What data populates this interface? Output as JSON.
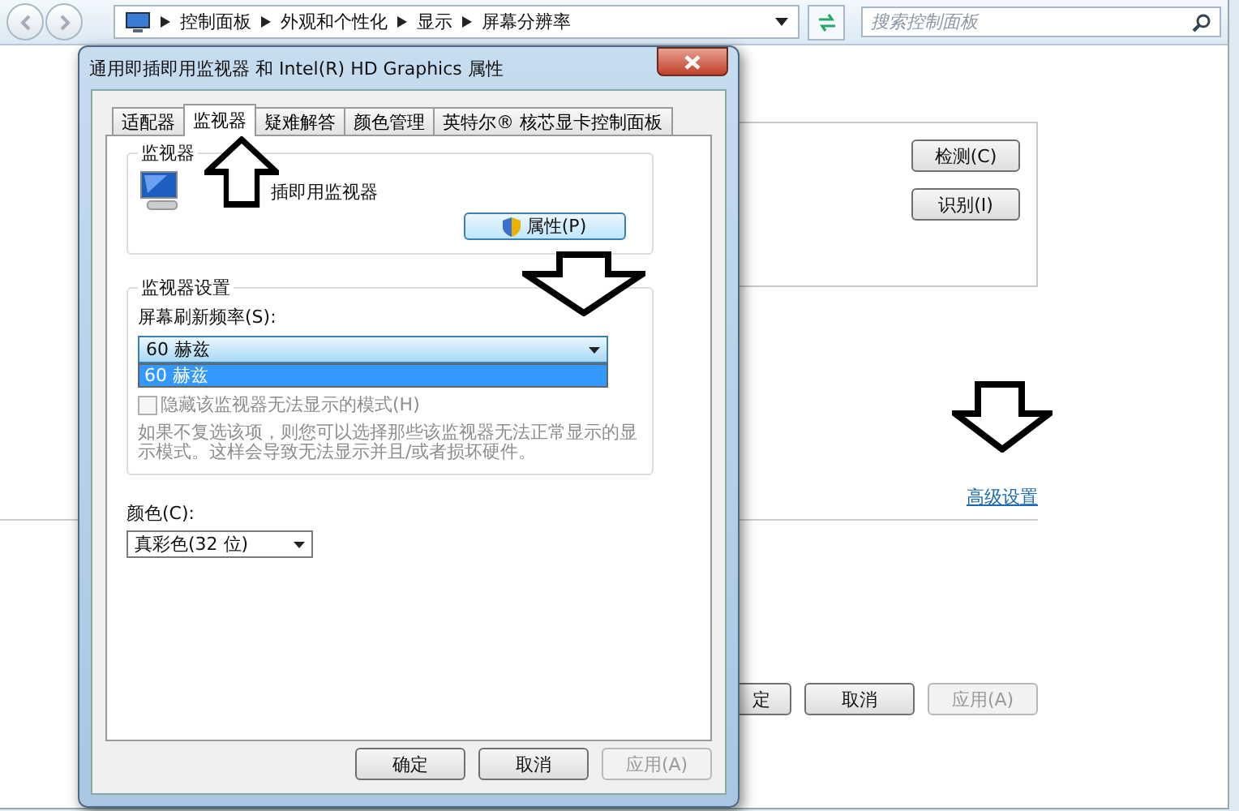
{
  "explorer": {
    "breadcrumb": [
      "控制面板",
      "外观和个性化",
      "显示",
      "屏幕分辨率"
    ],
    "search": {
      "placeholder": "搜索控制面板"
    },
    "side_buttons": [
      {
        "label": "检测(C)"
      },
      {
        "label": "识别(I)"
      }
    ],
    "advanced_link": "高级设置",
    "buttons": [
      {
        "label": "定",
        "disabled": false
      },
      {
        "label": "取消",
        "disabled": false
      },
      {
        "label": "应用(A)",
        "disabled": true
      }
    ]
  },
  "dialog": {
    "title": "通用即插即用监视器 和 Intel(R) HD Graphics 属性",
    "tabs": [
      {
        "label": "适配器",
        "selected": false
      },
      {
        "label": "监视器",
        "selected": true
      },
      {
        "label": "疑难解答",
        "selected": false
      },
      {
        "label": "颜色管理",
        "selected": false
      },
      {
        "label": "英特尔® 核芯显卡控制面板",
        "selected": false
      }
    ],
    "monitor_group": {
      "title": "监视器",
      "name": "插即用监视器",
      "button": "属性(P)"
    },
    "settings_group": {
      "title": "监视器设置",
      "refresh_label": "屏幕刷新频率(S):",
      "refresh_value": "60 赫兹",
      "expanded": true,
      "options": [
        {
          "label": "60 赫兹",
          "selected": true
        }
      ],
      "hide_modes": {
        "label": "隐藏该监视器无法显示的模式(H)",
        "checked": false,
        "disabled": true
      },
      "note": "如果不复选该项，则您可以选择那些该监视器无法正常显示的显示模式。这样会导致无法显示并且/或者损坏硬件。"
    },
    "color_label": "颜色(C):",
    "color_value": "真彩色(32 位)",
    "buttons": [
      {
        "label": "确定",
        "disabled": false
      },
      {
        "label": "取消",
        "disabled": false
      },
      {
        "label": "应用(A)",
        "disabled": true
      }
    ]
  }
}
